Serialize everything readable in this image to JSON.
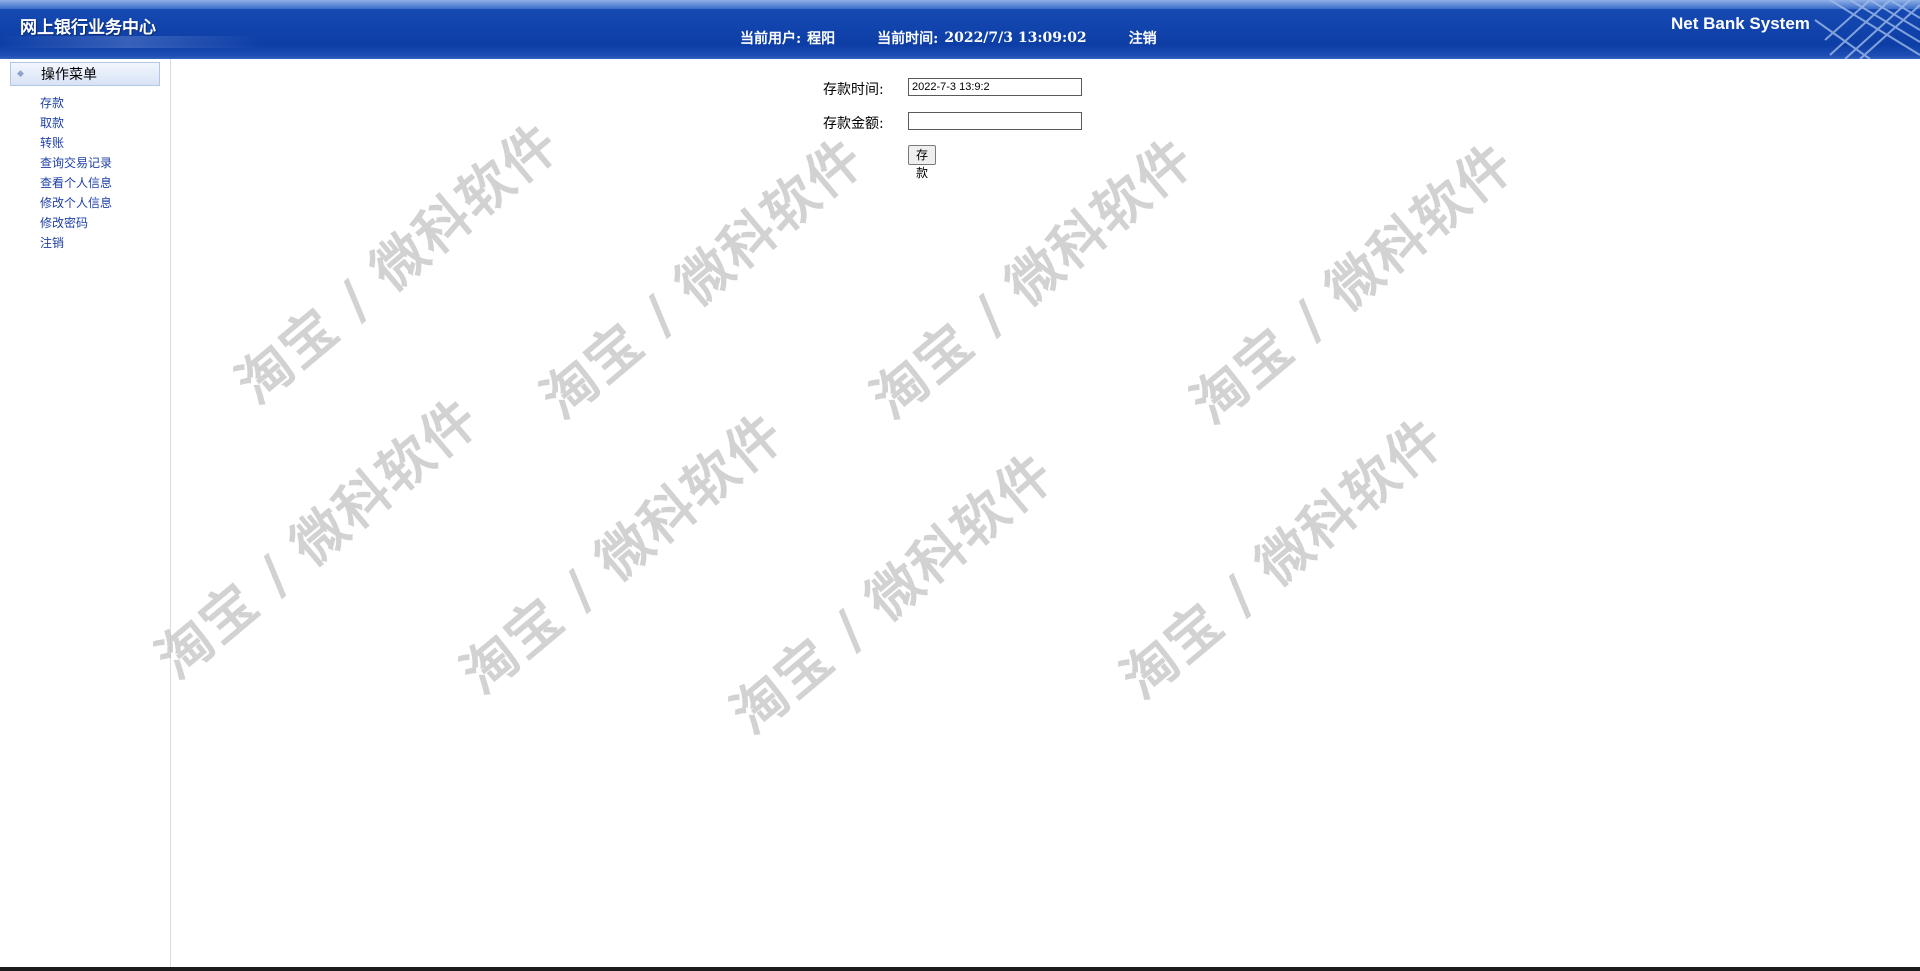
{
  "header": {
    "app_title": "网上银行业务中心",
    "user_label": "当前用户:",
    "user_name": "程阳",
    "time_label": "当前时间:",
    "time_value": "2022/7/3 13:09:02",
    "logout": "注销",
    "system_name": "Net Bank System"
  },
  "sidebar": {
    "menu_title": "操作菜单",
    "items": [
      "存款",
      "取款",
      "转账",
      "查询交易记录",
      "查看个人信息",
      "修改个人信息",
      "修改密码",
      "注销"
    ]
  },
  "form": {
    "time_label": "存款时间:",
    "time_value": "2022-7-3 13:9:2",
    "amount_label": "存款金额:",
    "amount_value": "",
    "submit_label": "存款"
  },
  "watermark": {
    "text": "淘宝 / 微科软件"
  },
  "colors": {
    "header": "#0d3ea6",
    "menu_link": "#1e3fa6",
    "watermark": "#c4c4c4"
  }
}
